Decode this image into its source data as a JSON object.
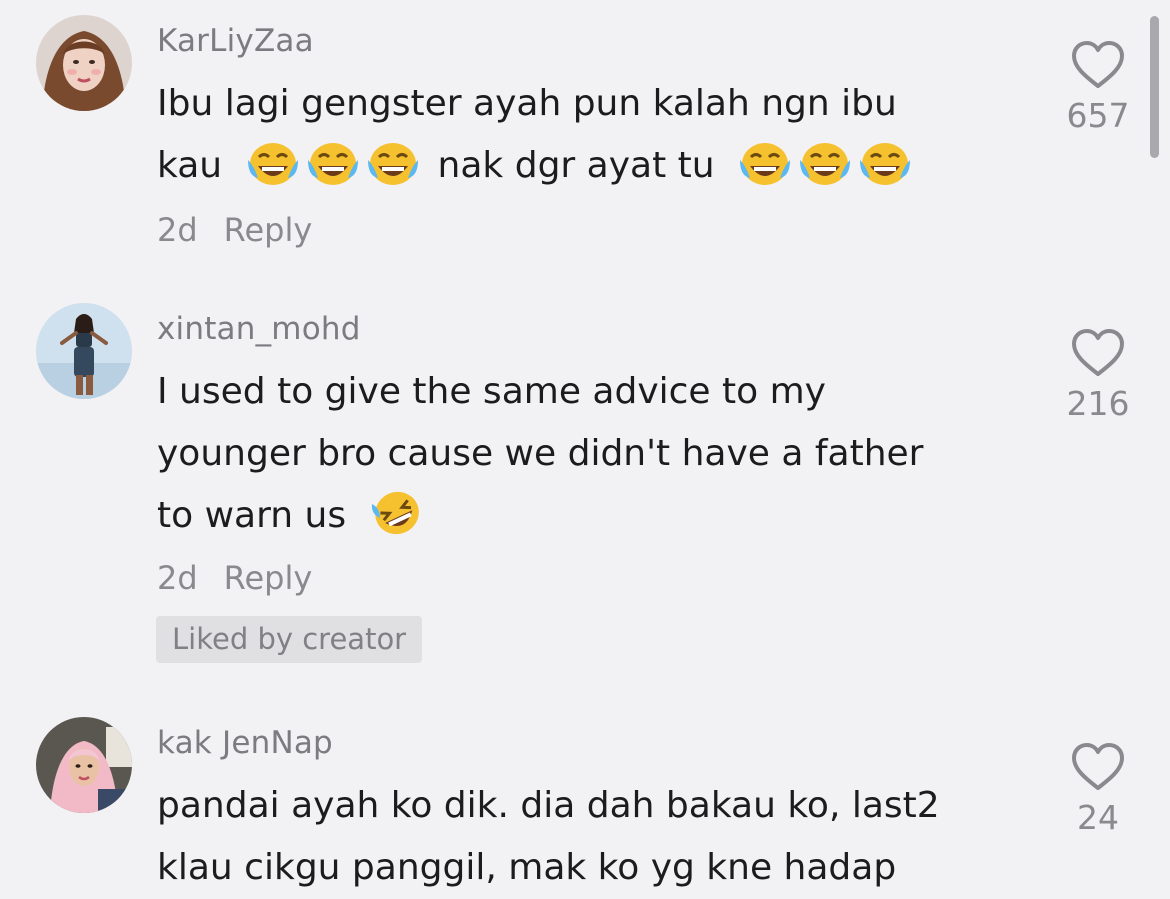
{
  "comments": [
    {
      "username": "KarLiyZaa",
      "lines": [
        "Ibu lagi gengster ayah pun kalah ngn ibu",
        "kau",
        "nak dgr ayat tu"
      ],
      "age": "2d",
      "reply_label": "Reply",
      "likes": "657",
      "emoji_a": "face-with-tears-of-joy",
      "emoji_b": "face-with-tears-of-joy"
    },
    {
      "username": "xintan_mohd",
      "lines": [
        "I used to give the same advice to my",
        "younger bro cause we didn't have a father",
        "to warn us"
      ],
      "age": "2d",
      "reply_label": "Reply",
      "liked_badge": "Liked by creator",
      "likes": "216",
      "emoji": "rolling-on-the-floor-laughing"
    },
    {
      "username": "kak JenNap",
      "lines": [
        "pandai ayah ko dik. dia dah bakau ko, last2",
        "klau cikgu panggil, mak ko yg kne hadap"
      ],
      "likes": "24"
    }
  ],
  "colors": {
    "background": "#f2f2f4",
    "username": "#7b7b80",
    "body_text": "#1c1c1e",
    "muted": "#8a8a8e",
    "badge_bg": "#e0e0e3"
  }
}
